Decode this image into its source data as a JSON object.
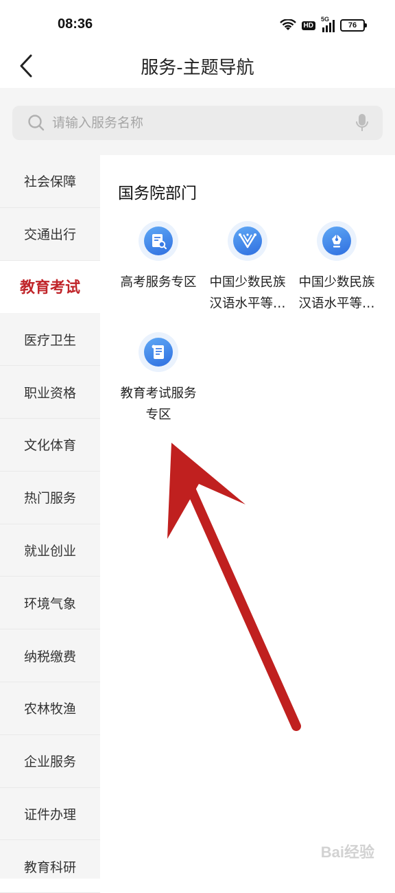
{
  "status": {
    "time": "08:36",
    "network_badge": "HD",
    "signal_label": "5G",
    "battery": "76"
  },
  "header": {
    "title": "服务-主题导航"
  },
  "search": {
    "placeholder": "请输入服务名称",
    "value": ""
  },
  "sidebar": {
    "items": [
      {
        "label": "社会保障"
      },
      {
        "label": "交通出行"
      },
      {
        "label": "教育考试",
        "active": true
      },
      {
        "label": "医疗卫生"
      },
      {
        "label": "职业资格"
      },
      {
        "label": "文化体育"
      },
      {
        "label": "热门服务"
      },
      {
        "label": "就业创业"
      },
      {
        "label": "环境气象"
      },
      {
        "label": "纳税缴费"
      },
      {
        "label": "农林牧渔"
      },
      {
        "label": "企业服务"
      },
      {
        "label": "证件办理"
      },
      {
        "label": "教育科研"
      }
    ]
  },
  "content": {
    "section_title": "国务院部门",
    "services": [
      {
        "label": "高考服务专区",
        "icon": "gaokao-icon"
      },
      {
        "label": "中国少数民族汉语水平等级考试",
        "icon": "ornament-icon"
      },
      {
        "label": "中国少数民族汉语水平等级考试",
        "icon": "pen-nib-icon"
      },
      {
        "label": "教育考试服务专区",
        "icon": "scroll-icon"
      }
    ]
  },
  "annotation": {
    "arrow_color": "#c0201f"
  },
  "watermark": {
    "text": "Bai经验"
  }
}
